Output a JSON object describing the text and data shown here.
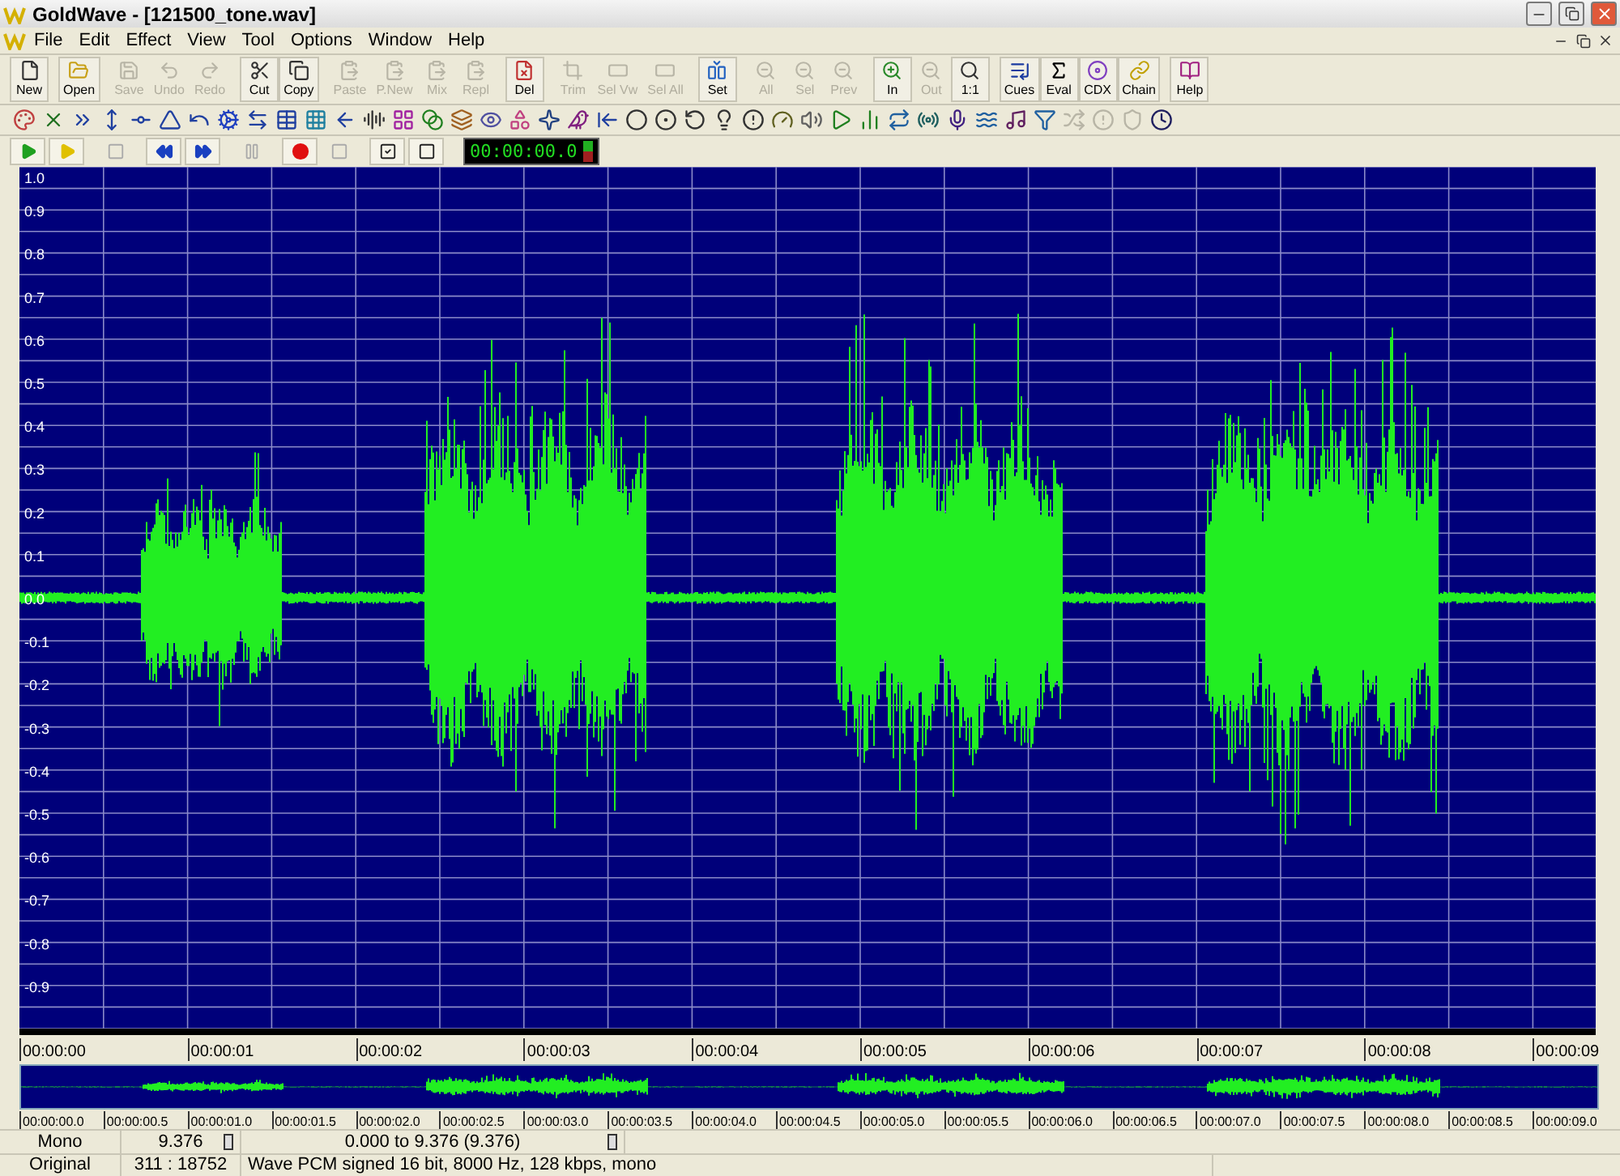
{
  "window": {
    "title": "GoldWave - [121500_tone.wav]"
  },
  "menu": [
    "File",
    "Edit",
    "Effect",
    "View",
    "Tool",
    "Options",
    "Window",
    "Help"
  ],
  "toolbar": [
    {
      "label": "New",
      "disabled": false
    },
    {
      "label": "Open",
      "disabled": false
    },
    {
      "label": "Save",
      "disabled": true
    },
    {
      "label": "Undo",
      "disabled": true
    },
    {
      "label": "Redo",
      "disabled": true
    },
    {
      "label": "Cut",
      "disabled": false
    },
    {
      "label": "Copy",
      "disabled": false
    },
    {
      "label": "Paste",
      "disabled": true
    },
    {
      "label": "P.New",
      "disabled": true
    },
    {
      "label": "Mix",
      "disabled": true
    },
    {
      "label": "Repl",
      "disabled": true
    },
    {
      "label": "Del",
      "disabled": false
    },
    {
      "label": "Trim",
      "disabled": true
    },
    {
      "label": "Sel Vw",
      "disabled": true
    },
    {
      "label": "Sel All",
      "disabled": true
    },
    {
      "label": "Set",
      "disabled": false
    },
    {
      "label": "All",
      "disabled": true
    },
    {
      "label": "Sel",
      "disabled": true
    },
    {
      "label": "Prev",
      "disabled": true
    },
    {
      "label": "In",
      "disabled": false
    },
    {
      "label": "Out",
      "disabled": true
    },
    {
      "label": "1:1",
      "disabled": false
    },
    {
      "label": "Cues",
      "disabled": false
    },
    {
      "label": "Eval",
      "disabled": false
    },
    {
      "label": "CDX",
      "disabled": false
    },
    {
      "label": "Chain",
      "disabled": false
    },
    {
      "label": "Help",
      "disabled": false
    }
  ],
  "effects_toolbar": [
    {
      "disabled": false
    },
    {
      "disabled": false
    },
    {
      "disabled": false
    },
    {
      "disabled": false
    },
    {
      "disabled": false
    },
    {
      "disabled": false
    },
    {
      "disabled": false
    },
    {
      "disabled": false
    },
    {
      "disabled": false
    },
    {
      "disabled": false
    },
    {
      "disabled": false
    },
    {
      "disabled": false
    },
    {
      "disabled": false
    },
    {
      "disabled": false
    },
    {
      "disabled": false
    },
    {
      "disabled": false
    },
    {
      "disabled": false
    },
    {
      "disabled": false
    },
    {
      "disabled": false
    },
    {
      "disabled": false
    },
    {
      "disabled": false
    },
    {
      "disabled": false
    },
    {
      "disabled": false
    },
    {
      "disabled": false
    },
    {
      "disabled": false
    },
    {
      "disabled": false
    },
    {
      "disabled": false
    },
    {
      "disabled": false
    },
    {
      "disabled": false
    },
    {
      "disabled": false
    },
    {
      "disabled": false
    },
    {
      "disabled": false
    },
    {
      "disabled": false
    },
    {
      "disabled": false
    },
    {
      "disabled": false
    },
    {
      "disabled": false
    },
    {
      "disabled": true
    },
    {
      "disabled": true
    },
    {
      "disabled": true
    },
    {
      "disabled": false
    }
  ],
  "transport": [
    {
      "kind": "play",
      "disabled": false
    },
    {
      "kind": "play-alt",
      "disabled": false
    },
    {
      "kind": "stop",
      "disabled": true
    },
    {
      "kind": "rewind",
      "disabled": false
    },
    {
      "kind": "forward",
      "disabled": false
    },
    {
      "kind": "pause",
      "disabled": true
    },
    {
      "kind": "record",
      "disabled": false
    },
    {
      "kind": "stop",
      "disabled": true
    },
    {
      "kind": "options",
      "disabled": false
    },
    {
      "kind": "window",
      "disabled": false
    }
  ],
  "time_display": "00:00:00.0",
  "amplitude_labels": [
    "1.0",
    "0.9",
    "0.8",
    "0.7",
    "0.6",
    "0.5",
    "0.4",
    "0.3",
    "0.2",
    "0.1",
    "0.0",
    "-0.1",
    "-0.2",
    "-0.3",
    "-0.4",
    "-0.5",
    "-0.6",
    "-0.7",
    "-0.8",
    "-0.9"
  ],
  "time_labels": [
    "00:00:00",
    "00:00:01",
    "00:00:02",
    "00:00:03",
    "00:00:04",
    "00:00:05",
    "00:00:06",
    "00:00:07",
    "00:00:08",
    "00:00:09"
  ],
  "overview_labels": [
    "00:00:00.0",
    "00:00:00.5",
    "00:00:01.0",
    "00:00:01.5",
    "00:00:02.0",
    "00:00:02.5",
    "00:00:03.0",
    "00:00:03.5",
    "00:00:04.0",
    "00:00:04.5",
    "00:00:05.0",
    "00:00:05.5",
    "00:00:06.0",
    "00:00:06.5",
    "00:00:07.0",
    "00:00:07.5",
    "00:00:08.0",
    "00:00:08.5",
    "00:00:09.0"
  ],
  "status_bar": [
    [
      "Mono",
      "9.376",
      "0.000 to 9.376 (9.376)"
    ],
    [
      "Original",
      "311 : 18752",
      "Wave PCM signed 16 bit, 8000 Hz, 128 kbps, mono"
    ]
  ]
}
